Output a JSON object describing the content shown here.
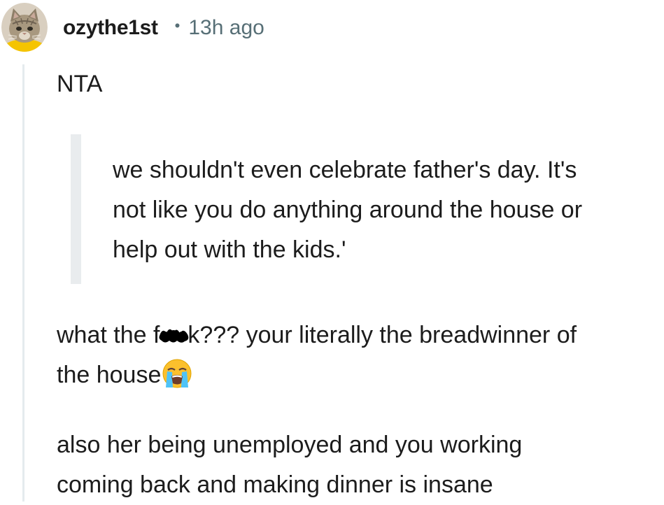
{
  "comment": {
    "author": "ozythe1st",
    "separator": "•",
    "timestamp": "13h ago",
    "paragraph_1": "NTA",
    "quote_lines": [
      "we shouldn't even celebrate father's day. It's",
      "not like you do anything around the house or",
      "help out with the kids.'"
    ],
    "paragraph_2_start": "what the f",
    "paragraph_2_after_censor": "k??? your literally the breadwinner of",
    "paragraph_2_line2": "the house",
    "paragraph_3_lines": [
      "also her being unemployed and you working",
      "coming back and making dinner is insane"
    ],
    "icons": {
      "avatar": "cat-avatar",
      "censor": "black-scribble-censor",
      "emoji": "loudly-crying-face-emoji"
    },
    "colors": {
      "text": "#1c1c1c",
      "meta": "#576f76",
      "thread_line": "#e5ebee",
      "quote_bar": "#e9ecee",
      "avatar_ring": "#f5c400"
    }
  }
}
